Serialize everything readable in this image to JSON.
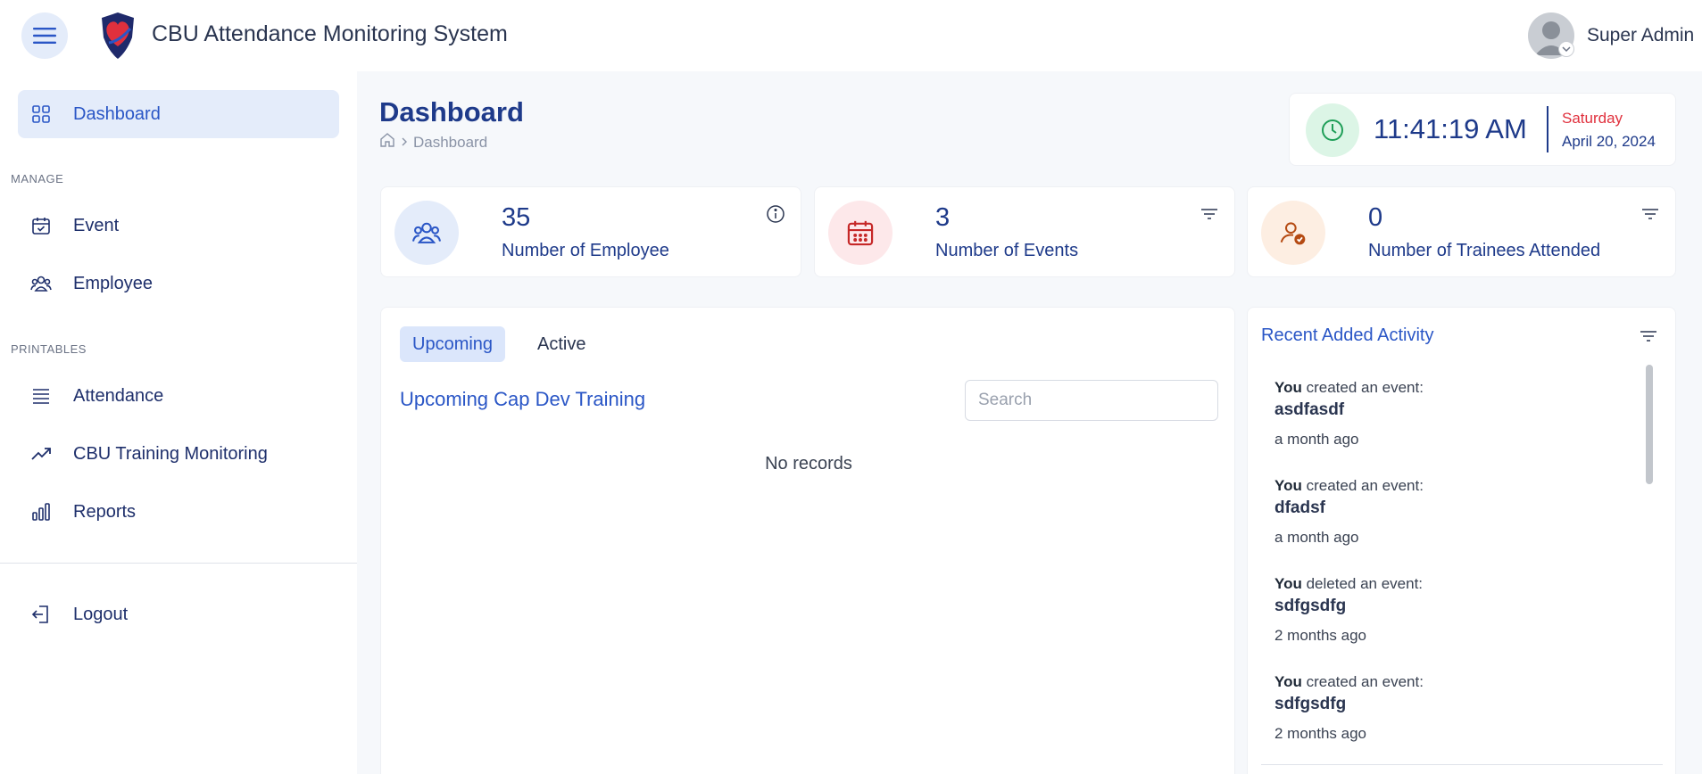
{
  "header": {
    "app_title": "CBU Attendance Monitoring System",
    "user_name": "Super Admin",
    "menu_icon": "hamburger-menu-icon",
    "logo_icon": "heart-shield-logo"
  },
  "sidebar": {
    "dashboard_label": "Dashboard",
    "manage_section": "MANAGE",
    "event_label": "Event",
    "employee_label": "Employee",
    "printables_section": "PRINTABLES",
    "attendance_label": "Attendance",
    "training_label": "CBU Training Monitoring",
    "reports_label": "Reports",
    "logout_label": "Logout"
  },
  "page": {
    "title": "Dashboard",
    "breadcrumb_current": "Dashboard"
  },
  "clock": {
    "time": "11:41:19 AM",
    "day": "Saturday",
    "date": "April 20, 2024"
  },
  "stats": {
    "employees": {
      "value": "35",
      "label": "Number of Employee"
    },
    "events": {
      "value": "3",
      "label": "Number of Events"
    },
    "trainees": {
      "value": "0",
      "label": "Number of Trainees Attended"
    }
  },
  "events_panel": {
    "tab_upcoming": "Upcoming",
    "tab_active": "Active",
    "title": "Upcoming Cap Dev Training",
    "search_placeholder": "Search",
    "empty_text": "No records"
  },
  "activity": {
    "title": "Recent Added Activity",
    "items": [
      {
        "actor": "You",
        "action": "created an event:",
        "target": "asdfasdf",
        "time": "a month ago"
      },
      {
        "actor": "You",
        "action": "created an event:",
        "target": "dfadsf",
        "time": "a month ago"
      },
      {
        "actor": "You",
        "action": "deleted an event:",
        "target": "sdfgsdfg",
        "time": "2 months ago"
      },
      {
        "actor": "You",
        "action": "created an event:",
        "target": "sdfgsdfg",
        "time": "2 months ago"
      }
    ]
  },
  "colors": {
    "accent": "#2a56c6",
    "navy": "#1e3a8a",
    "clock_green": "#1e9e57",
    "events_red": "#c62828",
    "trainee_orange": "#b54a12"
  }
}
